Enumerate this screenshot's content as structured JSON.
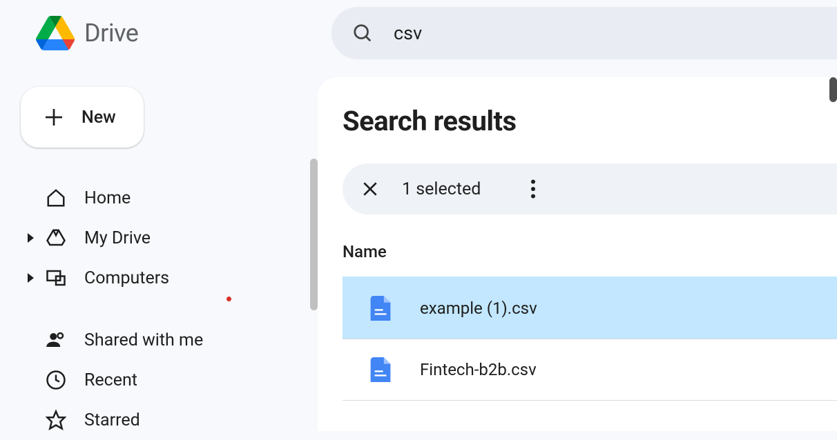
{
  "app": {
    "name": "Drive"
  },
  "search": {
    "value": "csv"
  },
  "new_button": {
    "label": "New"
  },
  "sidebar": {
    "items": [
      {
        "label": "Home",
        "icon": "home-icon",
        "expandable": false
      },
      {
        "label": "My Drive",
        "icon": "drive-icon",
        "expandable": true
      },
      {
        "label": "Computers",
        "icon": "computers-icon",
        "expandable": true
      },
      {
        "label": "Shared with me",
        "icon": "shared-icon",
        "expandable": false
      },
      {
        "label": "Recent",
        "icon": "recent-icon",
        "expandable": false
      },
      {
        "label": "Starred",
        "icon": "starred-icon",
        "expandable": false
      }
    ]
  },
  "main": {
    "heading": "Search results",
    "selection_text": "1 selected",
    "column_header": "Name",
    "files": [
      {
        "name": "example (1).csv",
        "selected": true
      },
      {
        "name": "Fintech-b2b.csv",
        "selected": false
      }
    ]
  },
  "colors": {
    "file_icon": "#4285f4",
    "selected_row": "#c2e7ff"
  }
}
